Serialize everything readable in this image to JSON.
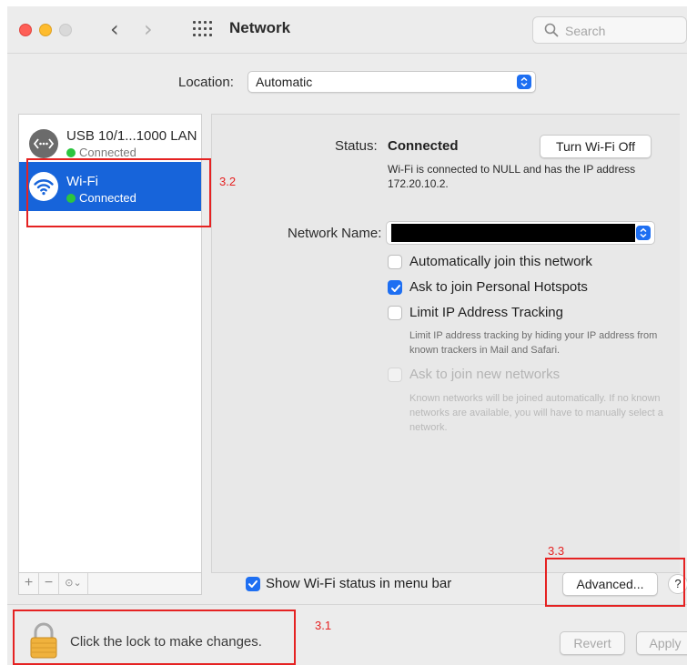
{
  "window": {
    "title": "Network",
    "search_placeholder": "Search"
  },
  "location": {
    "label": "Location:",
    "value": "Automatic"
  },
  "sidebar": {
    "services": [
      {
        "name": "USB 10/1...1000 LAN",
        "status": "Connected",
        "icon": "ethernet-icon"
      },
      {
        "name": "Wi-Fi",
        "status": "Connected",
        "icon": "wifi-icon",
        "selected": true
      }
    ],
    "buttons": {
      "add": "+",
      "remove": "−",
      "action": "⊙⌄"
    }
  },
  "detail": {
    "status_label": "Status:",
    "status_value": "Connected",
    "turn_off_label": "Turn Wi-Fi Off",
    "status_description": "Wi-Fi is connected to NULL and has the IP address 172.20.10.2.",
    "network_name_label": "Network Name:",
    "options": [
      {
        "label": "Automatically join this network",
        "checked": false,
        "enabled": true
      },
      {
        "label": "Ask to join Personal Hotspots",
        "checked": true,
        "enabled": true
      },
      {
        "label": "Limit IP Address Tracking",
        "checked": false,
        "enabled": true
      },
      {
        "label": "Ask to join new networks",
        "checked": false,
        "enabled": false
      }
    ],
    "limit_ip_note": "Limit IP address tracking by hiding your IP address from known trackers in Mail and Safari.",
    "new_networks_note": "Known networks will be joined automatically. If no known networks are available, you will have to manually select a network.",
    "show_status_label": "Show Wi-Fi status in menu bar",
    "advanced_label": "Advanced...",
    "help_label": "?"
  },
  "footer": {
    "lock_text": "Click the lock to make changes.",
    "revert_label": "Revert",
    "apply_label": "Apply"
  },
  "annotations": [
    {
      "label": "3.2"
    },
    {
      "label": "3.3"
    },
    {
      "label": "3.1"
    }
  ],
  "colors": {
    "accent": "#1e6ff2",
    "selection": "#1764da",
    "connected": "#2cc53f",
    "annotation": "#e52222"
  }
}
